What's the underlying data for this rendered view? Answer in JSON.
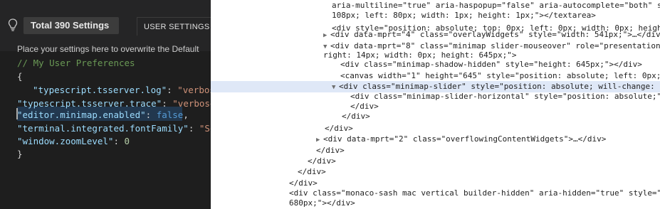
{
  "settings_editor": {
    "total_label": "Total 390 Settings",
    "tab_label": "USER SETTINGS",
    "info_text": "Place your settings here to overwrite the Default",
    "code": {
      "comment": "// My User Preferences",
      "open_brace": "{",
      "close_brace": "}",
      "entries": [
        {
          "key": "\"typescript.tsserver.log\"",
          "sep": ": ",
          "value": "\"verbose\"",
          "value_type": "string"
        },
        {
          "key": "\"typescript.tsserver.trace\"",
          "sep": ": ",
          "value": "\"verbose\"",
          "value_type": "string"
        },
        {
          "key": "\"editor.minimap.enabled\"",
          "sep": ": ",
          "value": "false",
          "trail": ",",
          "value_type": "keyword"
        },
        {
          "key": "\"terminal.integrated.fontFamily\"",
          "sep": ": ",
          "value": "\"Sou",
          "value_type": "string"
        },
        {
          "key": "\"window.zoomLevel\"",
          "sep": ": ",
          "value": "0",
          "value_type": "number"
        }
      ]
    }
  },
  "devtools": {
    "rows": [
      {
        "text": "aria-multiline=\"true\" aria-haspopup=\"false\" aria-autocomplete=\"both\" s"
      },
      {
        "text": "108px; left: 80px; width: 1px; height: 1px;\"></textarea>"
      },
      {
        "text": "<div style=\"position: absolute; top: 0px; left: 0px; width: 0px; heigh"
      },
      {
        "text": "<div data-mprt=\"4\" class=\"overlayWidgets\" style=\"width: 541px;\">…</div>"
      },
      {
        "text": "<div data-mprt=\"8\" class=\"minimap slider-mouseover\" role=\"presentation"
      },
      {
        "text": "right: 14px; width: 0px; height: 645px;\">"
      },
      {
        "text": "<div class=\"minimap-shadow-hidden\" style=\"height: 645px;\"></div>"
      },
      {
        "text": "<canvas width=\"1\" height=\"645\" style=\"position: absolute; left: 0px;"
      },
      {
        "text": "<div class=\"minimap-slider\" style=\"position: absolute; will-change:"
      },
      {
        "text": "<div class=\"minimap-slider-horizontal\" style=\"position: absolute;\""
      },
      {
        "text": "</div>"
      },
      {
        "text": "</div>"
      },
      {
        "text": "</div>"
      },
      {
        "text": "<div data-mprt=\"2\" class=\"overflowingContentWidgets\">…</div>"
      },
      {
        "text": "</div>"
      },
      {
        "text": "</div>"
      },
      {
        "text": "</div>"
      },
      {
        "text": "</div>"
      },
      {
        "text": "<div class=\"monaco-sash mac vertical builder-hidden\" aria-hidden=\"true\" style=\""
      },
      {
        "text": "680px;\"></div>"
      }
    ]
  }
}
